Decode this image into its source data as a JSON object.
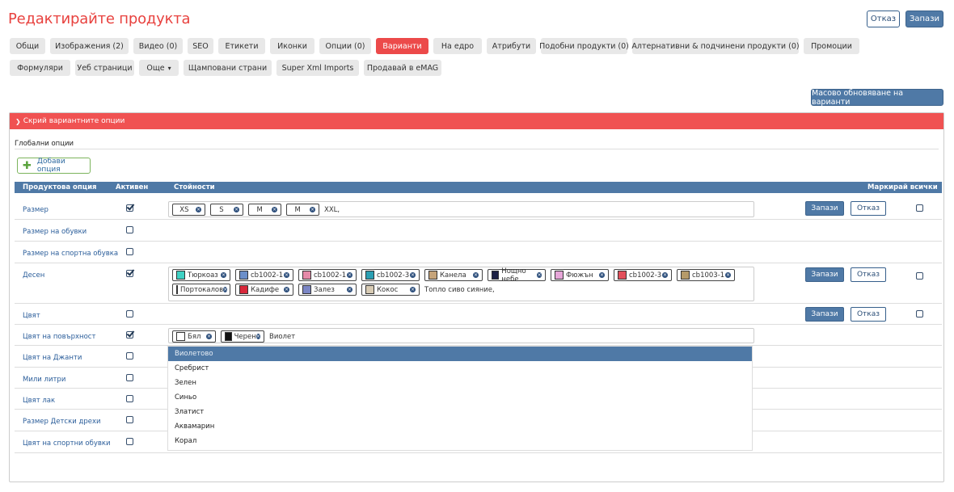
{
  "header": {
    "title": "Редактирайте продукта",
    "cancel_label": "Отказ",
    "save_label": "Запази"
  },
  "tabs": {
    "row1": [
      "Общи",
      "Изображения (2)",
      "Видео (0)",
      "SEO",
      "Етикети",
      "Иконки",
      "Опции (0)",
      "Варианти",
      "На едро",
      "Атрибути",
      "Подобни продукти (0)",
      "Алтернативни & подчинени продукти (0)",
      "Промоции"
    ],
    "row2": [
      "Формуляри",
      "Уеб страници",
      "Още",
      "Щамповани страни",
      "Super Xml Imports",
      "Продавай в eMAG"
    ],
    "active": "Варианти"
  },
  "mass_update_label": "Масово обновяване на варианти",
  "panel": {
    "toggle_label": "Скрий вариантните опции",
    "global_options_label": "Глобални опции",
    "add_option_label": "Добави опция"
  },
  "table": {
    "headers": {
      "option": "Продуктова опция",
      "active": "Активен",
      "values": "Стойности",
      "mark_all": "Маркирай всички"
    },
    "save_label": "Запази",
    "cancel_label": "Отказ",
    "rows": [
      {
        "label": "Размер",
        "active": true,
        "tags": [
          "XS",
          "S",
          "M",
          "M"
        ],
        "input": "XXL,"
      },
      {
        "label": "Размер на обувки",
        "active": false
      },
      {
        "label": "Размер на спортна обувка",
        "active": false
      },
      {
        "label": "Десен",
        "active": true,
        "tags": [
          {
            "label": "Тюркоаз",
            "color": "#3fd1c4"
          },
          {
            "label": "cb1002-1",
            "color": "#6c8fc9"
          },
          {
            "label": "cb1002-1",
            "color": "#e58aa8"
          },
          {
            "label": "cb1002-3",
            "color": "#2b9fb3"
          },
          {
            "label": "Канела",
            "color": "#c6a47a"
          },
          {
            "label": "Нощно небе",
            "color": "#1d2245"
          },
          {
            "label": "Фюжън",
            "color": "#e6a6d8"
          },
          {
            "label": "cb1002-3",
            "color": "#e2505c"
          },
          {
            "label": "cb1003-1",
            "color": "#b59a6a"
          },
          {
            "label": "Портокалов",
            "color": "#e7692e"
          },
          {
            "label": "Кадифе",
            "color": "#d8273a"
          },
          {
            "label": "Залез",
            "color": "#7b86c5"
          },
          {
            "label": "Кокос",
            "color": "#d8cbb4"
          }
        ],
        "input": "Топло сиво сияние,"
      },
      {
        "label": "Цвят",
        "active": false
      },
      {
        "label": "Цвят на повърхност",
        "active": true,
        "tags": [
          {
            "label": "Бял",
            "color": "#ffffff"
          },
          {
            "label": "Черен",
            "color": "#111111"
          }
        ],
        "input": "Виолет"
      },
      {
        "label": "Цвят на Джанти",
        "active": false
      },
      {
        "label": "Мили литри",
        "active": false
      },
      {
        "label": "Цвят лак",
        "active": false
      },
      {
        "label": "Размер Детски дрехи",
        "active": false
      },
      {
        "label": "Цвят на спортни обувки",
        "active": false
      }
    ]
  },
  "dropdown": [
    "Виолетово",
    "Сребрист",
    "Зелен",
    "Синьо",
    "Златист",
    "Аквамарин",
    "Корал"
  ]
}
